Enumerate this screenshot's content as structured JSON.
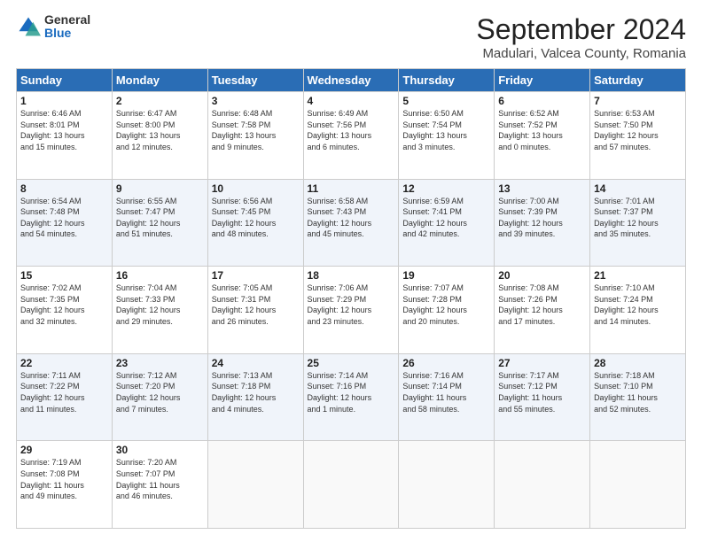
{
  "header": {
    "logo_general": "General",
    "logo_blue": "Blue",
    "main_title": "September 2024",
    "subtitle": "Madulari, Valcea County, Romania"
  },
  "calendar": {
    "headers": [
      "Sunday",
      "Monday",
      "Tuesday",
      "Wednesday",
      "Thursday",
      "Friday",
      "Saturday"
    ],
    "weeks": [
      [
        {
          "day": "1",
          "info": "Sunrise: 6:46 AM\nSunset: 8:01 PM\nDaylight: 13 hours\nand 15 minutes."
        },
        {
          "day": "2",
          "info": "Sunrise: 6:47 AM\nSunset: 8:00 PM\nDaylight: 13 hours\nand 12 minutes."
        },
        {
          "day": "3",
          "info": "Sunrise: 6:48 AM\nSunset: 7:58 PM\nDaylight: 13 hours\nand 9 minutes."
        },
        {
          "day": "4",
          "info": "Sunrise: 6:49 AM\nSunset: 7:56 PM\nDaylight: 13 hours\nand 6 minutes."
        },
        {
          "day": "5",
          "info": "Sunrise: 6:50 AM\nSunset: 7:54 PM\nDaylight: 13 hours\nand 3 minutes."
        },
        {
          "day": "6",
          "info": "Sunrise: 6:52 AM\nSunset: 7:52 PM\nDaylight: 13 hours\nand 0 minutes."
        },
        {
          "day": "7",
          "info": "Sunrise: 6:53 AM\nSunset: 7:50 PM\nDaylight: 12 hours\nand 57 minutes."
        }
      ],
      [
        {
          "day": "8",
          "info": "Sunrise: 6:54 AM\nSunset: 7:48 PM\nDaylight: 12 hours\nand 54 minutes."
        },
        {
          "day": "9",
          "info": "Sunrise: 6:55 AM\nSunset: 7:47 PM\nDaylight: 12 hours\nand 51 minutes."
        },
        {
          "day": "10",
          "info": "Sunrise: 6:56 AM\nSunset: 7:45 PM\nDaylight: 12 hours\nand 48 minutes."
        },
        {
          "day": "11",
          "info": "Sunrise: 6:58 AM\nSunset: 7:43 PM\nDaylight: 12 hours\nand 45 minutes."
        },
        {
          "day": "12",
          "info": "Sunrise: 6:59 AM\nSunset: 7:41 PM\nDaylight: 12 hours\nand 42 minutes."
        },
        {
          "day": "13",
          "info": "Sunrise: 7:00 AM\nSunset: 7:39 PM\nDaylight: 12 hours\nand 39 minutes."
        },
        {
          "day": "14",
          "info": "Sunrise: 7:01 AM\nSunset: 7:37 PM\nDaylight: 12 hours\nand 35 minutes."
        }
      ],
      [
        {
          "day": "15",
          "info": "Sunrise: 7:02 AM\nSunset: 7:35 PM\nDaylight: 12 hours\nand 32 minutes."
        },
        {
          "day": "16",
          "info": "Sunrise: 7:04 AM\nSunset: 7:33 PM\nDaylight: 12 hours\nand 29 minutes."
        },
        {
          "day": "17",
          "info": "Sunrise: 7:05 AM\nSunset: 7:31 PM\nDaylight: 12 hours\nand 26 minutes."
        },
        {
          "day": "18",
          "info": "Sunrise: 7:06 AM\nSunset: 7:29 PM\nDaylight: 12 hours\nand 23 minutes."
        },
        {
          "day": "19",
          "info": "Sunrise: 7:07 AM\nSunset: 7:28 PM\nDaylight: 12 hours\nand 20 minutes."
        },
        {
          "day": "20",
          "info": "Sunrise: 7:08 AM\nSunset: 7:26 PM\nDaylight: 12 hours\nand 17 minutes."
        },
        {
          "day": "21",
          "info": "Sunrise: 7:10 AM\nSunset: 7:24 PM\nDaylight: 12 hours\nand 14 minutes."
        }
      ],
      [
        {
          "day": "22",
          "info": "Sunrise: 7:11 AM\nSunset: 7:22 PM\nDaylight: 12 hours\nand 11 minutes."
        },
        {
          "day": "23",
          "info": "Sunrise: 7:12 AM\nSunset: 7:20 PM\nDaylight: 12 hours\nand 7 minutes."
        },
        {
          "day": "24",
          "info": "Sunrise: 7:13 AM\nSunset: 7:18 PM\nDaylight: 12 hours\nand 4 minutes."
        },
        {
          "day": "25",
          "info": "Sunrise: 7:14 AM\nSunset: 7:16 PM\nDaylight: 12 hours\nand 1 minute."
        },
        {
          "day": "26",
          "info": "Sunrise: 7:16 AM\nSunset: 7:14 PM\nDaylight: 11 hours\nand 58 minutes."
        },
        {
          "day": "27",
          "info": "Sunrise: 7:17 AM\nSunset: 7:12 PM\nDaylight: 11 hours\nand 55 minutes."
        },
        {
          "day": "28",
          "info": "Sunrise: 7:18 AM\nSunset: 7:10 PM\nDaylight: 11 hours\nand 52 minutes."
        }
      ],
      [
        {
          "day": "29",
          "info": "Sunrise: 7:19 AM\nSunset: 7:08 PM\nDaylight: 11 hours\nand 49 minutes."
        },
        {
          "day": "30",
          "info": "Sunrise: 7:20 AM\nSunset: 7:07 PM\nDaylight: 11 hours\nand 46 minutes."
        },
        {
          "day": "",
          "info": ""
        },
        {
          "day": "",
          "info": ""
        },
        {
          "day": "",
          "info": ""
        },
        {
          "day": "",
          "info": ""
        },
        {
          "day": "",
          "info": ""
        }
      ]
    ]
  }
}
